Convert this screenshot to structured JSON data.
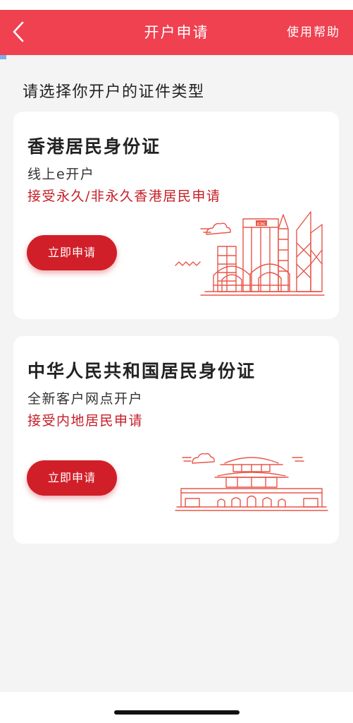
{
  "nav": {
    "title": "开户申请",
    "help": "使用帮助",
    "back_icon": "chevron-left-icon",
    "background": "#ef4150"
  },
  "section_title": "请选择你开户的证件类型",
  "cards": [
    {
      "title": "香港居民身份证",
      "subtitle": "线上e开户",
      "note": "接受永久/非永久香港居民申请",
      "button": "立即申请",
      "illustration": "hong-kong-skyline-icon",
      "building_label": "ICBC"
    },
    {
      "title": "中华人民共和国居民身份证",
      "subtitle": "全新客户网点开户",
      "note": "接受内地居民申请",
      "button": "立即申请",
      "illustration": "tiananmen-gate-icon"
    }
  ],
  "colors": {
    "accent": "#ef4150",
    "note_red": "#c61d26",
    "button_red": "#d11f29",
    "page_bg": "#f4f4f4",
    "card_bg": "#ffffff"
  }
}
